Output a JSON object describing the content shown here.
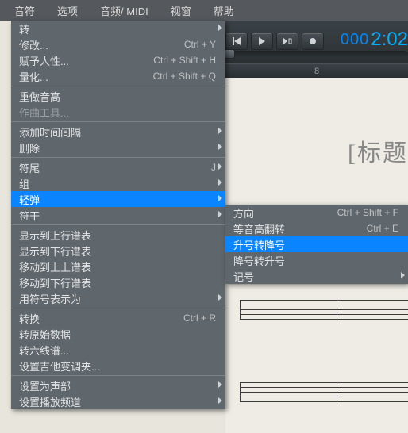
{
  "menubar": {
    "items": [
      "音符",
      "选项",
      "音频/ MIDI",
      "视窗",
      "帮助"
    ]
  },
  "transport": {
    "counter_bars": "000",
    "counter_time": "2:02"
  },
  "ruler": {
    "label": "8"
  },
  "score": {
    "title": "[标题"
  },
  "menu1": {
    "g1": [
      {
        "label": "转",
        "arrow": true
      },
      {
        "label": "修改...",
        "accel": "Ctrl + Y"
      },
      {
        "label": "赋予人性...",
        "accel": "Ctrl + Shift + H"
      },
      {
        "label": "量化...",
        "accel": "Ctrl + Shift + Q"
      }
    ],
    "g2": [
      {
        "label": "重做音高"
      },
      {
        "label": "作曲工具...",
        "disabled": true
      }
    ],
    "g3": [
      {
        "label": "添加时间间隔",
        "arrow": true
      },
      {
        "label": "删除",
        "arrow": true
      }
    ],
    "g4": [
      {
        "label": "符尾",
        "arrow": true,
        "trail": "J"
      },
      {
        "label": "组",
        "arrow": true
      },
      {
        "label": "轻弹",
        "arrow": true,
        "hl": true
      },
      {
        "label": "符干",
        "arrow": true
      }
    ],
    "g5": [
      {
        "label": "显示到上行谱表"
      },
      {
        "label": "显示到下行谱表"
      },
      {
        "label": "移动到上上谱表"
      },
      {
        "label": "移动到下行谱表"
      },
      {
        "label": "用符号表示为",
        "arrow": true
      }
    ],
    "g6": [
      {
        "label": "转换",
        "accel": "Ctrl + R"
      },
      {
        "label": "转原始数据"
      },
      {
        "label": "转六线谱..."
      },
      {
        "label": "设置吉他变调夹..."
      }
    ],
    "g7": [
      {
        "label": "设置为声部",
        "arrow": true
      },
      {
        "label": "设置播放频道",
        "arrow": true
      }
    ]
  },
  "menu2": {
    "items": [
      {
        "label": "方向",
        "accel": "Ctrl + Shift + F"
      },
      {
        "label": "等音高翻转",
        "accel": "Ctrl + E"
      },
      {
        "label": "升号转降号",
        "hl": true
      },
      {
        "label": "降号转升号"
      },
      {
        "label": "记号",
        "arrow": true
      }
    ]
  }
}
